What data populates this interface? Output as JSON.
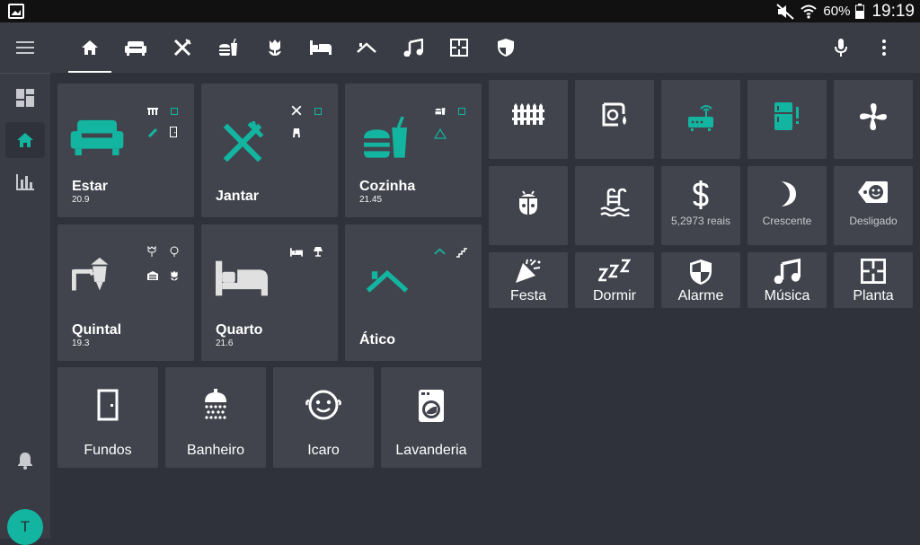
{
  "status": {
    "battery": "60%",
    "time": "19:19"
  },
  "colors": {
    "accent": "#13b5a0",
    "card": "#41444d",
    "background": "#2f323a",
    "bar": "#393c44"
  },
  "topbar": {
    "tabs": [
      "home-icon",
      "sofa-icon",
      "cutlery-icon",
      "food-icon",
      "flower-icon",
      "bed-icon",
      "roof-icon",
      "music-icon",
      "floorplan-icon",
      "shield-icon"
    ],
    "active_tab": "home-icon",
    "actions": [
      "microphone-icon",
      "more-vertical-icon"
    ]
  },
  "sidebar": {
    "items": [
      "dashboard-icon",
      "home-icon",
      "chart-icon"
    ],
    "active": "home-icon",
    "bottom": [
      "bell-icon"
    ],
    "avatar_initial": "T"
  },
  "rooms": [
    {
      "name": "Estar",
      "value": "20.9",
      "icon": "sofa-icon"
    },
    {
      "name": "Jantar",
      "value": "",
      "icon": "cutlery-icon"
    },
    {
      "name": "Cozinha",
      "value": "21.45",
      "icon": "food-icon"
    },
    {
      "name": "Quintal",
      "value": "19.3",
      "icon": "garden-lamp-icon"
    },
    {
      "name": "Quarto",
      "value": "21.6",
      "icon": "bed-icon"
    },
    {
      "name": "Ático",
      "value": "",
      "icon": "roof-icon"
    }
  ],
  "small_rooms": [
    {
      "name": "Fundos",
      "icon": "door-icon"
    },
    {
      "name": "Banheiro",
      "icon": "shower-icon"
    },
    {
      "name": "Icaro",
      "icon": "baby-face-icon"
    },
    {
      "name": "Lavanderia",
      "icon": "washing-machine-icon"
    }
  ],
  "tiles": [
    {
      "icon": "fence-icon",
      "sub": ""
    },
    {
      "icon": "water-meter-icon",
      "sub": ""
    },
    {
      "icon": "router-icon",
      "sub": ""
    },
    {
      "icon": "fridge-alert-icon",
      "sub": ""
    },
    {
      "icon": "fan-icon",
      "sub": ""
    },
    {
      "icon": "bug-icon",
      "sub": ""
    },
    {
      "icon": "pool-icon",
      "sub": ""
    },
    {
      "icon": "dollar-icon",
      "sub": "5,2973 reais"
    },
    {
      "icon": "moon-icon",
      "sub": "Crescente"
    },
    {
      "icon": "tag-face-icon",
      "sub": "Desligado"
    }
  ],
  "scenes": [
    {
      "name": "Festa",
      "icon": "party-popper-icon"
    },
    {
      "name": "Dormir",
      "icon": "sleep-icon"
    },
    {
      "name": "Alarme",
      "icon": "shield-icon"
    },
    {
      "name": "Música",
      "icon": "music-icon"
    },
    {
      "name": "Planta",
      "icon": "floorplan-icon"
    }
  ]
}
